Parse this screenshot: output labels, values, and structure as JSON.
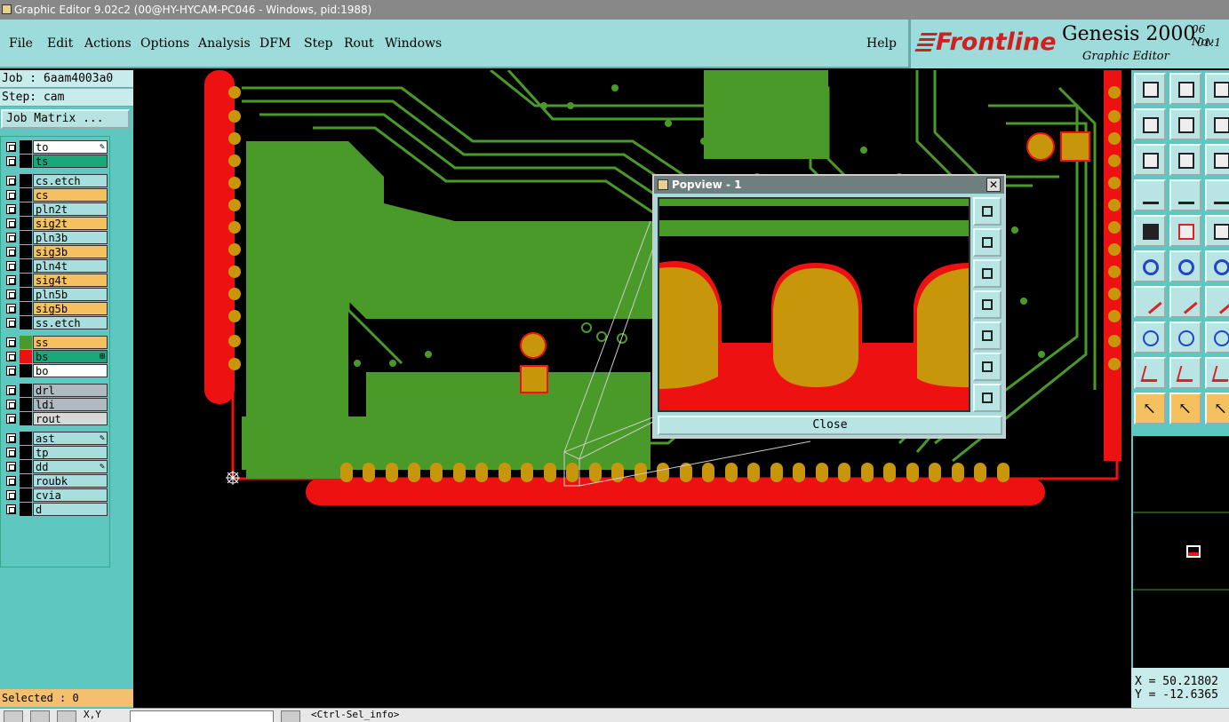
{
  "window": {
    "title": "Graphic Editor 9.02c2 (00@HY-HYCAM-PC046 - Windows, pid:1988)"
  },
  "menu": {
    "items": [
      {
        "label": "File",
        "u": "F"
      },
      {
        "label": "Edit",
        "u": "E"
      },
      {
        "label": "Actions",
        "u": "A"
      },
      {
        "label": "Options",
        "u": "O"
      },
      {
        "label": "Analysis",
        "u": "A"
      },
      {
        "label": "DFM",
        "u": "D"
      },
      {
        "label": "Step",
        "u": "S"
      },
      {
        "label": "Rout",
        "u": "R"
      },
      {
        "label": "Windows",
        "u": "W"
      }
    ],
    "help": "Help"
  },
  "brand": {
    "logo": "Frontline",
    "product": "Genesis 2000",
    "subtitle": "Graphic Editor",
    "date": "06 Nov",
    "time": "01:1"
  },
  "job": {
    "job_label": "Job : 6aam4003a0",
    "step_label": "Step: cam",
    "matrix_button": "Job Matrix ..."
  },
  "layers": [
    {
      "name": "to",
      "color": "#ffffff",
      "swatch": "#000000",
      "mark": "✎"
    },
    {
      "name": "ts",
      "color": "#1aa87a",
      "swatch": "#000000",
      "mark": ""
    },
    {
      "name": "cs.etch",
      "color": "#a8dede",
      "swatch": "#000000",
      "mark": ""
    },
    {
      "name": "cs",
      "color": "#f4c060",
      "swatch": "#000000",
      "mark": ""
    },
    {
      "name": "pln2t",
      "color": "#a8dede",
      "swatch": "#000000",
      "mark": ""
    },
    {
      "name": "sig2t",
      "color": "#f4c060",
      "swatch": "#000000",
      "mark": ""
    },
    {
      "name": "pln3b",
      "color": "#a8dede",
      "swatch": "#000000",
      "mark": ""
    },
    {
      "name": "sig3b",
      "color": "#f4c060",
      "swatch": "#000000",
      "mark": ""
    },
    {
      "name": "pln4t",
      "color": "#a8dede",
      "swatch": "#000000",
      "mark": ""
    },
    {
      "name": "sig4t",
      "color": "#f4c060",
      "swatch": "#000000",
      "mark": ""
    },
    {
      "name": "pln5b",
      "color": "#a8dede",
      "swatch": "#000000",
      "mark": ""
    },
    {
      "name": "sig5b",
      "color": "#f4c060",
      "swatch": "#000000",
      "mark": ""
    },
    {
      "name": "ss.etch",
      "color": "#a8dede",
      "swatch": "#000000",
      "mark": ""
    },
    {
      "name": "ss",
      "color": "#f4c060",
      "swatch": "#4a9a2a",
      "mark": ""
    },
    {
      "name": "bs",
      "color": "#1aa87a",
      "swatch": "#ee1111",
      "mark": "⊞"
    },
    {
      "name": "bo",
      "color": "#ffffff",
      "swatch": "#000000",
      "mark": ""
    },
    {
      "name": "drl",
      "color": "#b0b8c0",
      "swatch": "#000000",
      "mark": ""
    },
    {
      "name": "ldi",
      "color": "#b0b8c0",
      "swatch": "#000000",
      "mark": ""
    },
    {
      "name": "rout",
      "color": "#d8d8d8",
      "swatch": "#000000",
      "mark": ""
    },
    {
      "name": "ast",
      "color": "#a8dede",
      "swatch": "#000000",
      "mark": "✎"
    },
    {
      "name": "tp",
      "color": "#a8dede",
      "swatch": "#000000",
      "mark": ""
    },
    {
      "name": "dd",
      "color": "#a8dede",
      "swatch": "#000000",
      "mark": "✎"
    },
    {
      "name": "roubk",
      "color": "#a8dede",
      "swatch": "#000000",
      "mark": ""
    },
    {
      "name": "cvia",
      "color": "#a8dede",
      "swatch": "#000000",
      "mark": ""
    },
    {
      "name": "d",
      "color": "#a8dede",
      "swatch": "#000000",
      "mark": ""
    }
  ],
  "selected_label": "Selected : 0",
  "popview": {
    "title": "Popview - 1",
    "close_label": "Close"
  },
  "coords": {
    "x_label": "X = 50.21802",
    "y_label": "Y = -12.6365"
  },
  "status": {
    "xy_label": "X,Y",
    "message": "<Ctrl-Sel_info>"
  },
  "colors": {
    "board_green": "#4a9a2a",
    "copper_gold": "#c8960a",
    "mask_red": "#ee1111",
    "panel_cyan": "#5ec8c0",
    "menu_cyan": "#9edcdc"
  }
}
